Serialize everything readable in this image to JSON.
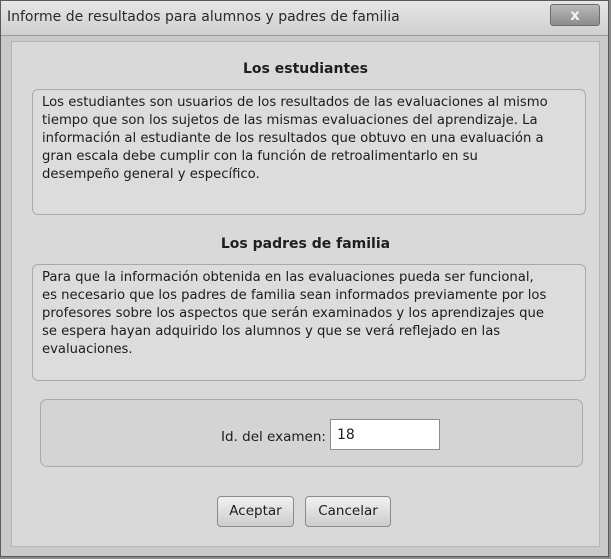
{
  "window": {
    "title": "Informe de resultados para alumnos y padres de familia",
    "close_glyph": "x"
  },
  "students": {
    "heading": "Los estudiantes",
    "lines": [
      "Los estudiantes son usuarios de los resultados de las evaluaciones al mismo",
      "tiempo que son los sujetos de las mismas evaluaciones del aprendizaje. La",
      "información al estudiante de los resultados que obtuvo en una evaluación a",
      "gran escala debe cumplir con la función de retroalimentarlo en su",
      "desempeño general y específico."
    ]
  },
  "parents": {
    "heading": "Los padres de familia",
    "lines": [
      "Para que la información obtenida en las evaluaciones pueda ser funcional,",
      "es necesario que los padres de familia sean informados previamente por los",
      "profesores sobre los aspectos que serán examinados y los aprendizajes que",
      "se espera hayan adquirido los alumnos y que se verá reflejado en las",
      "evaluaciones."
    ]
  },
  "exam": {
    "label": "Id. del examen:",
    "value": "18"
  },
  "buttons": {
    "accept": "Aceptar",
    "cancel": "Cancelar"
  }
}
